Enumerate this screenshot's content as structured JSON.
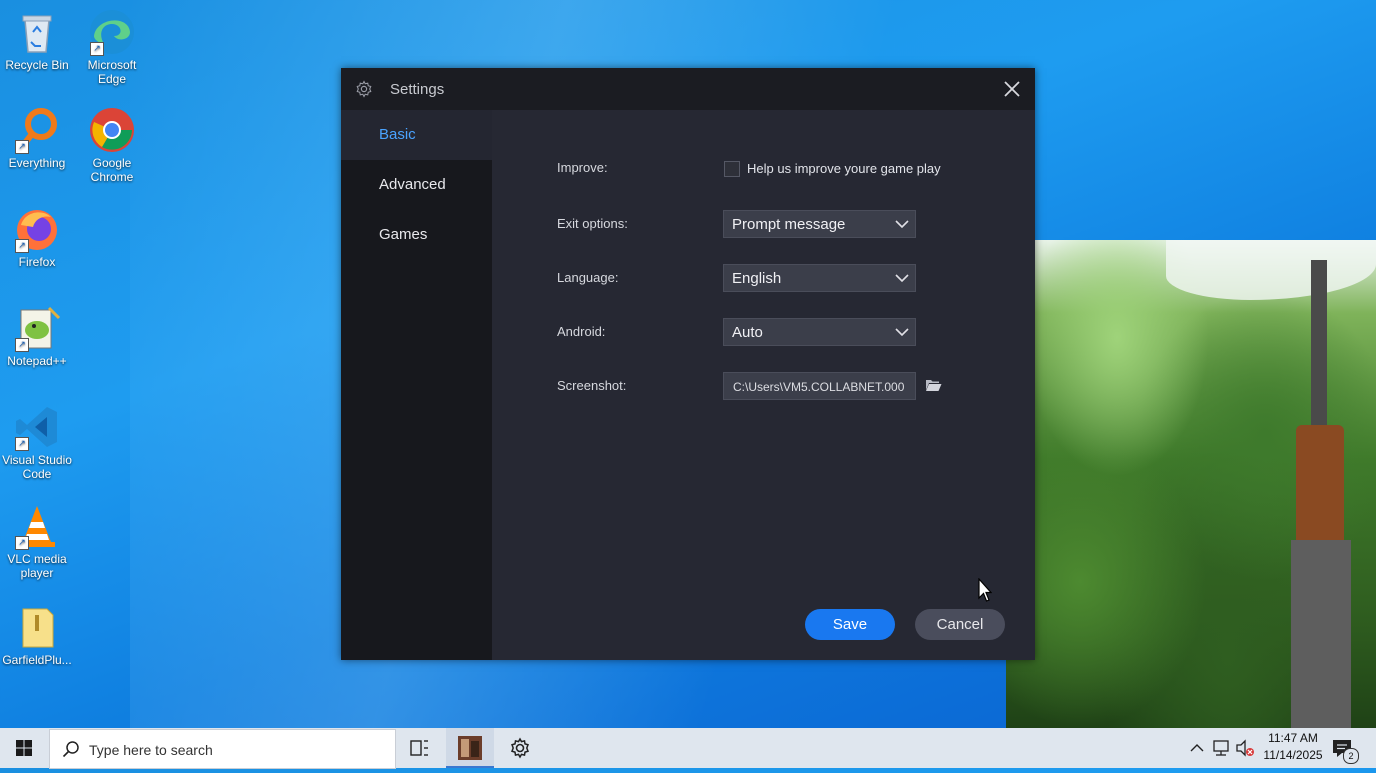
{
  "desktop": {
    "icons": [
      {
        "name": "Recycle Bin"
      },
      {
        "name": "Microsoft Edge"
      },
      {
        "name": "Everything"
      },
      {
        "name": "Google Chrome"
      },
      {
        "name": "Firefox"
      },
      {
        "name": "Notepad++"
      },
      {
        "name": "Visual Studio Code"
      },
      {
        "name": "VLC media player"
      },
      {
        "name": "GarfieldPlu..."
      }
    ]
  },
  "dialog": {
    "title": "Settings",
    "sidebar": {
      "items": [
        {
          "label": "Basic",
          "active": true
        },
        {
          "label": "Advanced",
          "active": false
        },
        {
          "label": "Games",
          "active": false
        }
      ]
    },
    "improve": {
      "label": "Improve:",
      "checkbox_label": "Help us improve youre game play",
      "checked": false
    },
    "exit_options": {
      "label": "Exit options:",
      "value": "Prompt message"
    },
    "language": {
      "label": "Language:",
      "value": "English"
    },
    "android": {
      "label": "Android:",
      "value": "Auto"
    },
    "screenshot": {
      "label": "Screenshot:",
      "value": "C:\\Users\\VM5.COLLABNET.000"
    },
    "buttons": {
      "save": "Save",
      "cancel": "Cancel"
    }
  },
  "taskbar": {
    "search_placeholder": "Type here to search",
    "clock": {
      "time": "11:47 AM",
      "date": "11/14/2025"
    },
    "notification_count": "2"
  },
  "colors": {
    "accent": "#1978f0",
    "active_tab": "#4aa3ff",
    "dialog_bg": "#262833",
    "sidebar_bg": "#17181d"
  }
}
